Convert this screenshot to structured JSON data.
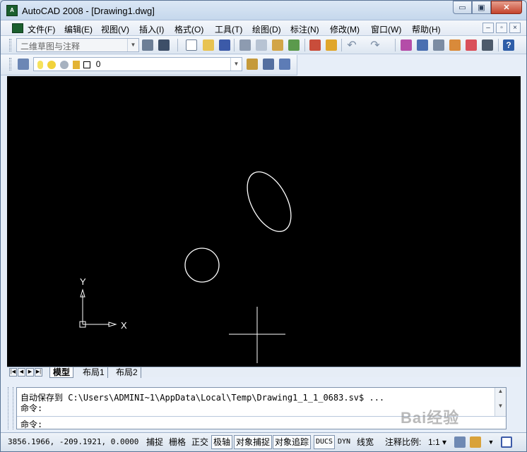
{
  "window": {
    "title": "AutoCAD 2008 - [Drawing1.dwg]",
    "min": "▭",
    "max": "▣",
    "close": "✕"
  },
  "menu": {
    "items": [
      "文件(F)",
      "编辑(E)",
      "视图(V)",
      "插入(I)",
      "格式(O)",
      "工具(T)",
      "绘图(D)",
      "标注(N)",
      "修改(M)",
      "窗口(W)",
      "帮助(H)"
    ],
    "mdi": [
      "–",
      "▫",
      "×"
    ]
  },
  "toolbar1": {
    "workspace": "二维草图与注释"
  },
  "toolbar2": {
    "layer": "0"
  },
  "canvas": {
    "x_label": "X",
    "y_label": "Y",
    "bg": "#000000",
    "fg": "#ffffff"
  },
  "tabs": {
    "items": [
      "模型",
      "布局1",
      "布局2"
    ],
    "active": 0
  },
  "command": {
    "line1": "自动保存到 C:\\Users\\ADMINI~1\\AppData\\Local\\Temp\\Drawing1_1_1_0683.sv$ ...",
    "line2": "命令:",
    "prompt": "命令:"
  },
  "status": {
    "coords": "3856.1966, -209.1921, 0.0000",
    "buttons": [
      "捕捉",
      "栅格",
      "正交",
      "极轴",
      "对象捕捉",
      "对象追踪",
      "DUCS",
      "DYN",
      "线宽"
    ],
    "on": [
      3,
      4,
      5,
      6
    ],
    "scale_label": "注释比例:",
    "scale_value": "1:1"
  },
  "watermark": "Bai经验"
}
